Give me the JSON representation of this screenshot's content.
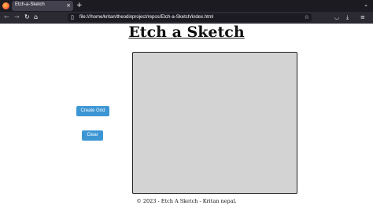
{
  "browser": {
    "tab_title": "Etch-a-Sketch",
    "tab_close": "×",
    "new_tab": "+",
    "tab_list": "⌄",
    "url": "file:///home/kritan/theodinproject/repos/Etch-a-Sketch/index.html",
    "icons": [
      "firefox-logo",
      "back-icon",
      "forward-icon",
      "reload-icon",
      "home-icon",
      "file-icon",
      "star-icon",
      "pocket-icon",
      "downloads-icon",
      "menu-icon"
    ]
  },
  "page": {
    "title": "Etch a Sketch",
    "create_label": "Create Grid",
    "clear_label": "Clear",
    "footer": "© 2023 - Etch A Sketch - Kritan nepal."
  },
  "colors": {
    "button": "#3d96d4",
    "grid_background": "#d3d3d3",
    "grid_border": "#222222"
  }
}
